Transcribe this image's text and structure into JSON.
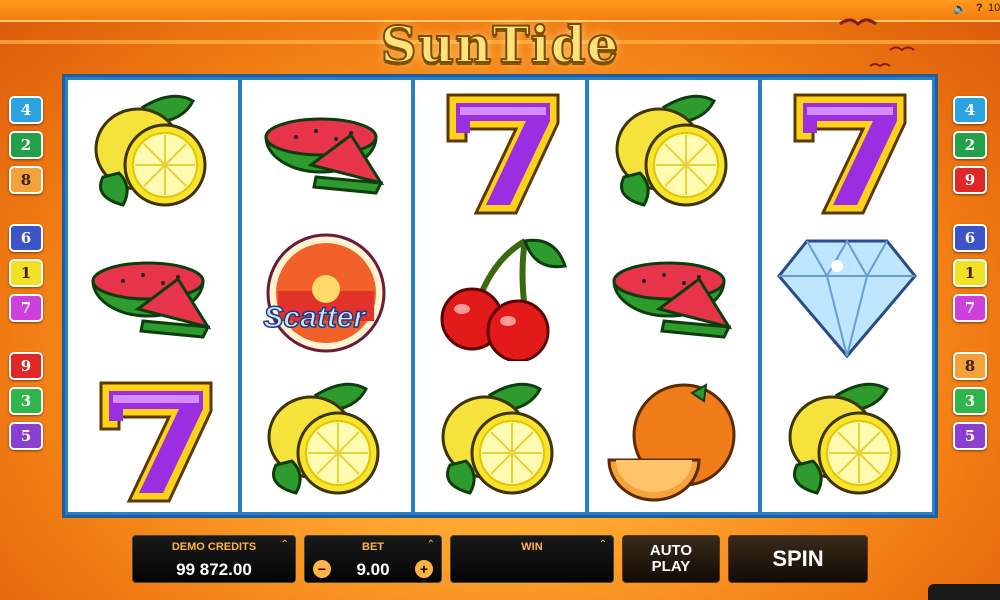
{
  "game": {
    "title": "SunTide"
  },
  "system": {
    "sound_icon": "speaker-icon",
    "help": "?",
    "clock": "10"
  },
  "paylines": {
    "left": [
      {
        "n": "4",
        "c": "#29a4e0"
      },
      {
        "n": "2",
        "c": "#22a04a"
      },
      {
        "n": "8",
        "c": "#f3a23a"
      },
      {
        "n": "6",
        "c": "#3c54c8"
      },
      {
        "n": "1",
        "c": "#f2e227"
      },
      {
        "n": "7",
        "c": "#cf3fdc"
      },
      {
        "n": "9",
        "c": "#e02626"
      },
      {
        "n": "3",
        "c": "#2fb54a"
      },
      {
        "n": "5",
        "c": "#8a3fd1"
      }
    ],
    "right": [
      {
        "n": "4",
        "c": "#29a4e0"
      },
      {
        "n": "2",
        "c": "#22a04a"
      },
      {
        "n": "9",
        "c": "#e02626"
      },
      {
        "n": "6",
        "c": "#3c54c8"
      },
      {
        "n": "1",
        "c": "#f2e227"
      },
      {
        "n": "7",
        "c": "#cf3fdc"
      },
      {
        "n": "8",
        "c": "#f3a23a"
      },
      {
        "n": "3",
        "c": "#2fb54a"
      },
      {
        "n": "5",
        "c": "#8a3fd1"
      }
    ]
  },
  "reels": [
    [
      "lemon",
      "watermelon",
      "seven"
    ],
    [
      "watermelon",
      "scatter",
      "lemon"
    ],
    [
      "seven",
      "cherries",
      "lemon"
    ],
    [
      "lemon",
      "watermelon",
      "orange"
    ],
    [
      "seven",
      "diamond",
      "lemon"
    ]
  ],
  "scatter_label": "Scatter",
  "controls": {
    "credits_label": "DEMO CREDITS",
    "credits_value": "99 872.00",
    "bet_label": "BET",
    "bet_value": "9.00",
    "bet_minus": "−",
    "bet_plus": "+",
    "win_label": "WIN",
    "win_value": "",
    "autoplay_label": "AUTO PLAY",
    "spin_label": "SPIN"
  }
}
